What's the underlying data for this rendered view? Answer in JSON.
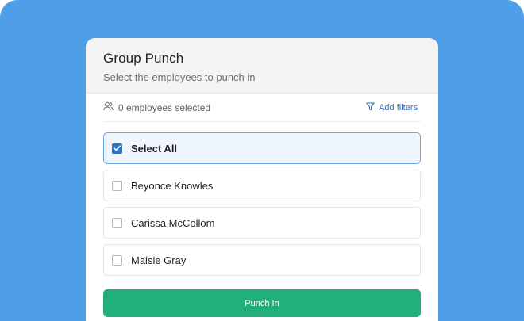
{
  "colors": {
    "background": "#4f9fe8",
    "accent": "#2a74c9",
    "primary_button": "#21b07c"
  },
  "header": {
    "title": "Group Punch",
    "subtitle": "Select the employees to punch in"
  },
  "toolbar": {
    "selected_count_label": "0 employees selected",
    "selected_icon": "users-icon",
    "add_filters_label": "Add filters",
    "filter_icon": "filter-icon"
  },
  "list": {
    "select_all": {
      "label": "Select All",
      "checked": true
    },
    "employees": [
      {
        "name": "Beyonce Knowles",
        "checked": false
      },
      {
        "name": "Carissa McCollom",
        "checked": false
      },
      {
        "name": "Maisie Gray",
        "checked": false
      }
    ]
  },
  "actions": {
    "punch_in_label": "Punch In"
  }
}
